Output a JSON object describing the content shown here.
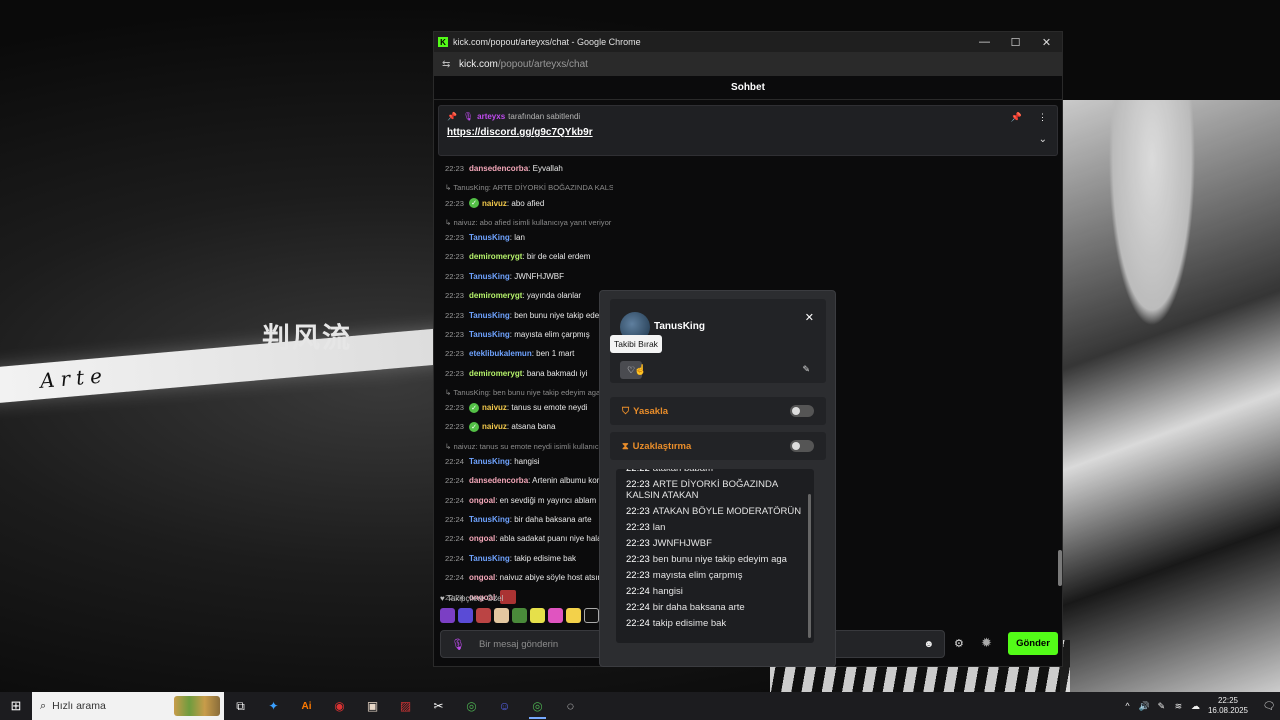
{
  "window": {
    "title": "kick.com/popout/arteyxs/chat - Google Chrome",
    "controls": {
      "minimize": "—",
      "maximize": "☐",
      "close": "✕"
    }
  },
  "address": {
    "host": "kick.com",
    "path": "/popout/arteyxs/chat"
  },
  "chat": {
    "header": "Sohbet",
    "pinned": {
      "author": "arteyxs",
      "suffix": "tarafından sabitlendi",
      "link": "https://discord.gg/g9c7QYkb9r"
    },
    "messages": [
      {
        "time": "22:23",
        "user": "dansedencorba",
        "color": "#f4a7b9",
        "text": ": Eyvallah"
      },
      {
        "reply": "↳ TanusKing: ARTE DİYORKİ BOĞAZINDA KALSIN ATAKAN isimli kullanıcıya yanıt veriyor"
      },
      {
        "time": "22:23",
        "user": "naivuz",
        "color": "#f2c94c",
        "text": ": abo afied",
        "badge": true
      },
      {
        "reply": "↳ naivuz: abo afied isimli kullanıcıya yanıt veriyor"
      },
      {
        "time": "22:23",
        "user": "TanusKing",
        "color": "#6fa3ff",
        "text": ": lan"
      },
      {
        "time": "22:23",
        "user": "demiromerygt",
        "color": "#b6f36b",
        "text": ": bir de celal erdem"
      },
      {
        "time": "22:23",
        "user": "TanusKing",
        "color": "#6fa3ff",
        "text": ": JWNFHJWBF"
      },
      {
        "time": "22:23",
        "user": "demiromerygt",
        "color": "#b6f36b",
        "text": ": yayında olanlar"
      },
      {
        "time": "22:23",
        "user": "TanusKing",
        "color": "#6fa3ff",
        "text": ": ben bunu niye takip edeyim aga"
      },
      {
        "time": "22:23",
        "user": "TanusKing",
        "color": "#6fa3ff",
        "text": ": mayısta elim çarpmış"
      },
      {
        "time": "22:23",
        "user": "eteklibukalemun",
        "color": "#6fa3ff",
        "text": ": ben 1 mart"
      },
      {
        "time": "22:23",
        "user": "demiromerygt",
        "color": "#b6f36b",
        "text": ": bana bakmadı iyi"
      },
      {
        "reply": "↳ TanusKing: ben bunu niye takip edeyim aga isimli kullanıcıya yanıt veriyor"
      },
      {
        "time": "22:23",
        "user": "naivuz",
        "color": "#f2c94c",
        "text": ": tanus su emote neydi",
        "badge": true
      },
      {
        "time": "22:23",
        "user": "naivuz",
        "color": "#f2c94c",
        "text": ": atsana bana",
        "badge": true
      },
      {
        "reply": "↳ naivuz: tanus su emote neydi isimli kullanıcıya yanıt veriyor"
      },
      {
        "time": "22:24",
        "user": "TanusKing",
        "color": "#6fa3ff",
        "text": ": hangisi"
      },
      {
        "time": "22:24",
        "user": "dansedencorba",
        "color": "#f4a7b9",
        "text": ": Artenin albumu kompleks"
      },
      {
        "time": "22:24",
        "user": "ongoal",
        "color": "#f4a7b9",
        "text": ": en sevdiği m yayıncı ablam"
      },
      {
        "time": "22:24",
        "user": "TanusKing",
        "color": "#6fa3ff",
        "text": ": bir daha baksana arte"
      },
      {
        "time": "22:24",
        "user": "ongoal",
        "color": "#f4a7b9",
        "text": ": abla sadakat puanı niye hala"
      },
      {
        "time": "22:24",
        "user": "TanusKing",
        "color": "#6fa3ff",
        "text": ": takip edisime bak"
      },
      {
        "time": "22:24",
        "user": "ongoal",
        "color": "#f4a7b9",
        "text": ": naivuz abiye söyle host atsın"
      },
      {
        "time": "22:24",
        "user": "ongoal",
        "color": "#f4a7b9",
        "text": ":",
        "emote": true
      }
    ],
    "followers_label": "♥ Takipçilere Özel",
    "input_placeholder": "Bir mesaj gönderin",
    "send_label": "Gönder"
  },
  "usercard": {
    "username": "TanusKing",
    "tooltip": "Takibi Bırak",
    "ban_label": "Yasakla",
    "timeout_label": "Uzaklaştırma",
    "history": [
      {
        "time": "22:22",
        "text": "atakan babam"
      },
      {
        "time": "22:23",
        "text": "ARTE DİYORKİ BOĞAZINDA KALSIN ATAKAN"
      },
      {
        "time": "22:23",
        "text": "ATAKAN BÖYLE MODERATÖRÜN"
      },
      {
        "time": "22:23",
        "text": "lan"
      },
      {
        "time": "22:23",
        "text": "JWNFHJWBF"
      },
      {
        "time": "22:23",
        "text": "ben bunu niye takip edeyim aga"
      },
      {
        "time": "22:23",
        "text": "mayısta elim çarpmış"
      },
      {
        "time": "22:24",
        "text": "hangisi"
      },
      {
        "time": "22:24",
        "text": "bir daha baksana arte"
      },
      {
        "time": "22:24",
        "text": "takip edisime bak"
      }
    ]
  },
  "wallpaper": {
    "kanji": "判风流",
    "word": "Arte"
  },
  "taskbar": {
    "search_placeholder": "Hızlı arama",
    "clock_time": "22:25",
    "clock_date": "16.08.2025"
  }
}
